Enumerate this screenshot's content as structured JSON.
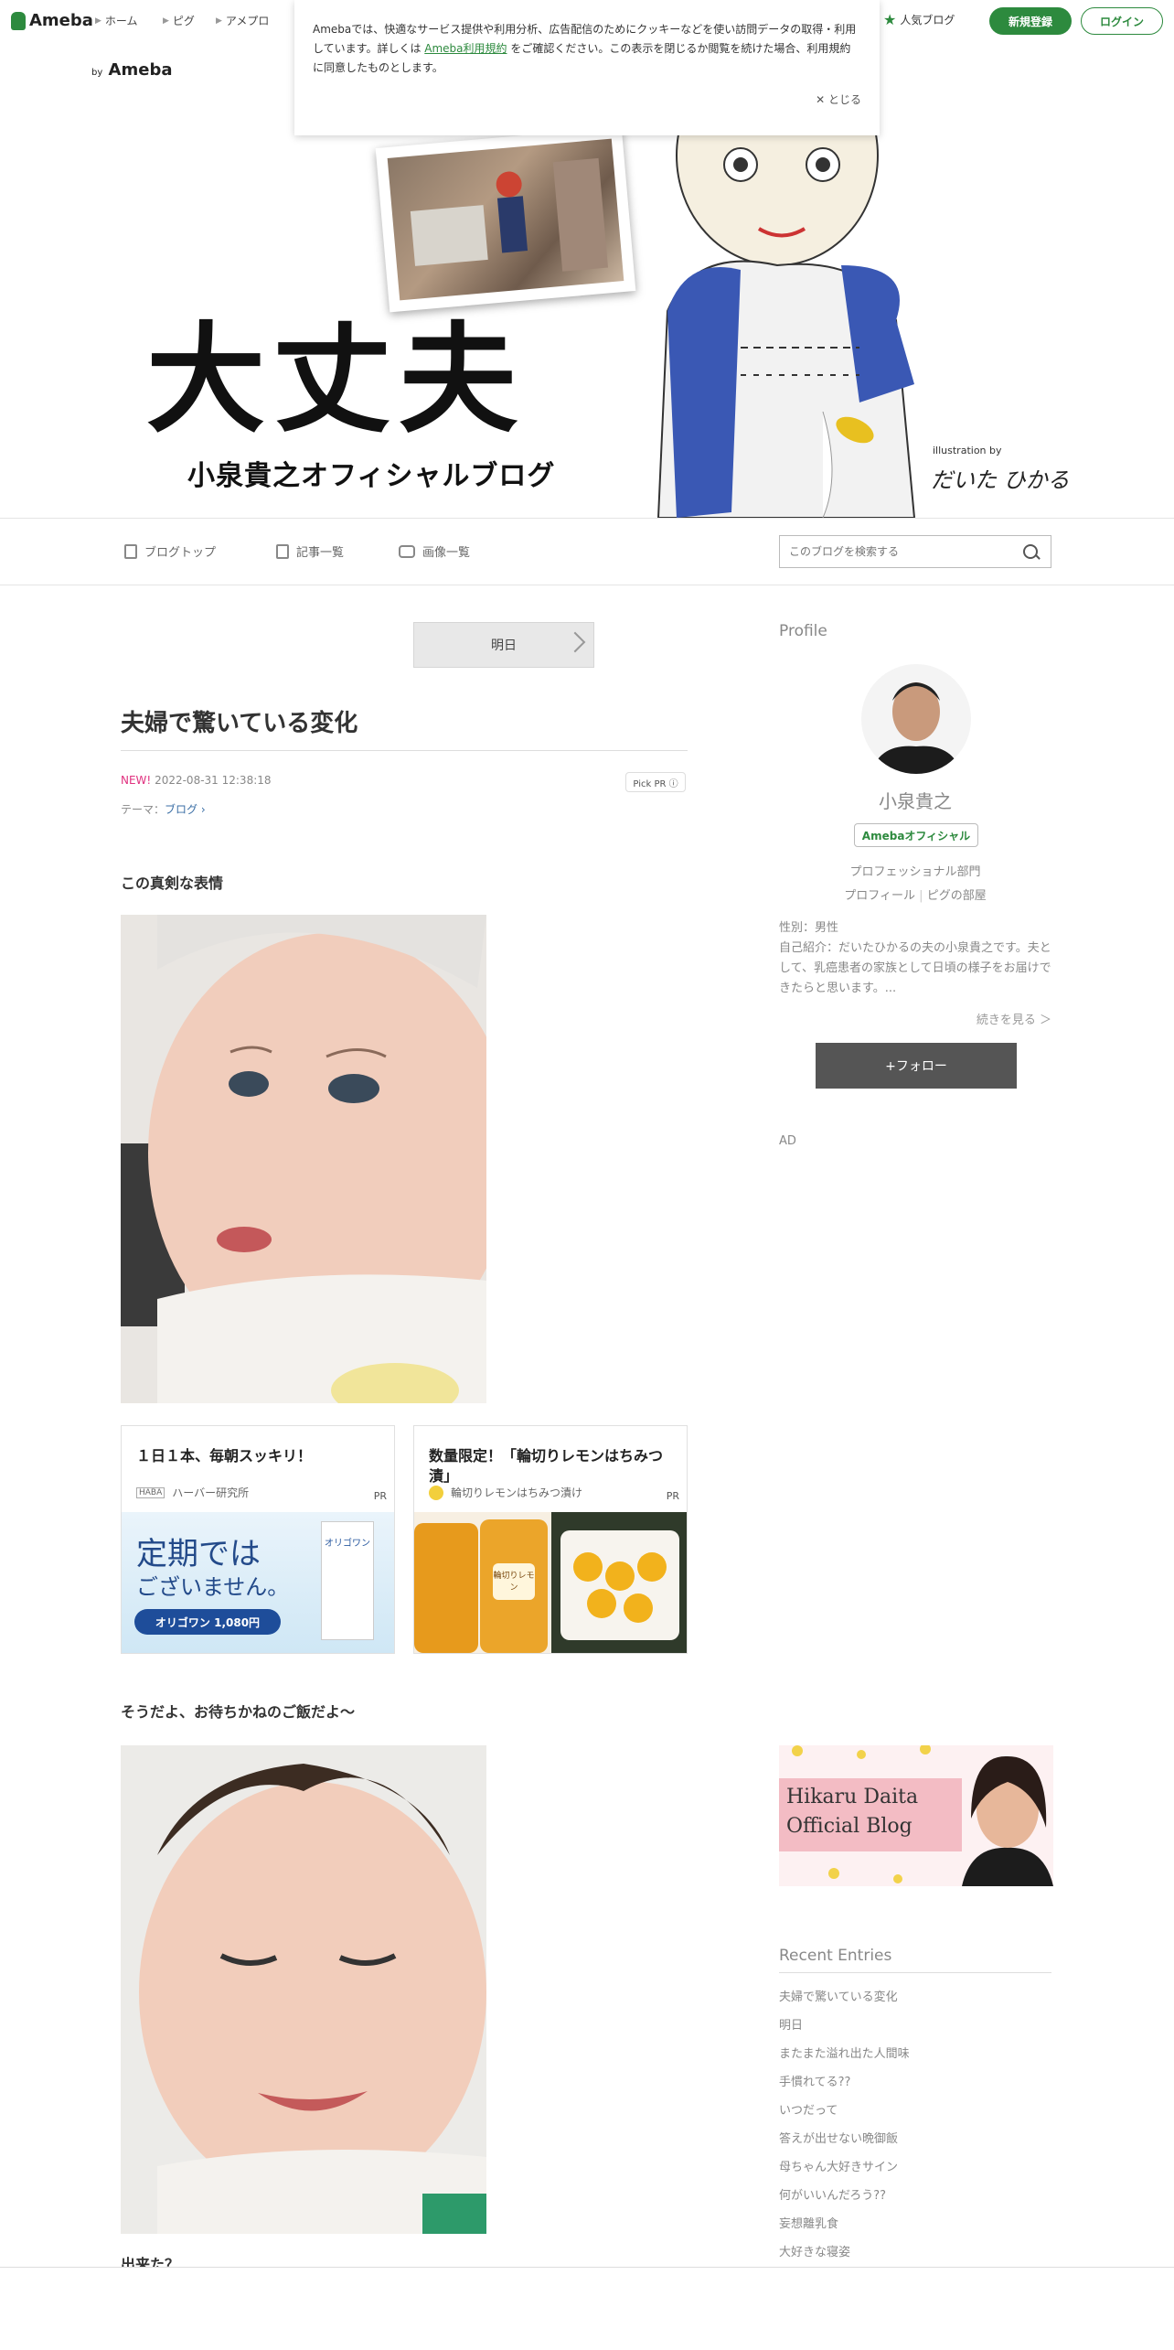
{
  "topbar": {
    "logo": "Ameba",
    "nav": [
      "ホーム",
      "ピグ",
      "アメプロ"
    ],
    "popular": "人気ブログ",
    "register": "新規登録",
    "login": "ログイン"
  },
  "cookie": {
    "text_before": "Amebaでは、快適なサービス提供や利用分析、広告配信のためにクッキーなどを使い訪問データの取得・利用しています。詳しくは ",
    "link": "Ameba利用規約",
    "text_after": " をご確認ください。この表示を閉じるか閲覧を続けた場合、利用規約に同意したものとします。",
    "close": "✕ とじる"
  },
  "header": {
    "by_ameba": "Ameba",
    "by_prefix": "by",
    "title": "大丈夫",
    "subtitle": "小泉貴之オフィシャルブログ",
    "illustration_by": "illustration by",
    "signature": "だいた ひかる"
  },
  "blog_nav": {
    "items": [
      "ブログトップ",
      "記事一覧",
      "画像一覧"
    ],
    "search_placeholder": "このブログを検索する"
  },
  "entry": {
    "next_label": "明日",
    "title": "夫婦で驚いている変化",
    "new_badge": "NEW!",
    "datetime": "2022-08-31 12:38:18",
    "pickpr": "Pick PR ⓘ",
    "theme_label": "テーマ：",
    "theme": "ブログ ›",
    "heading1": "この真剣な表情",
    "heading2": "そうだよ、お待ちかねのご飯だよ〜",
    "heading3": "出来た？"
  },
  "ads": [
    {
      "title": "１日１本、毎朝スッキリ！",
      "sponsor": "ハーバー研究所",
      "sponsor_logo": "HABA",
      "pr": "PR",
      "img_text1": "定期では",
      "img_text2": "ございません。",
      "img_text3": "オリゴワン 1,080円",
      "product": "オリゴワン"
    },
    {
      "title": "数量限定！「輪切りレモンはちみつ漬」",
      "sponsor": "輪切りレモンはちみつ漬け",
      "pr": "PR",
      "jar_label": "輪切りレモン"
    }
  ],
  "sidebar": {
    "profile_heading": "Profile",
    "name": "小泉貴之",
    "badge": "Amebaオフィシャル",
    "category": "プロフェッショナル部門",
    "links": [
      "プロフィール",
      "ピグの部屋"
    ],
    "gender": "性別：男性",
    "intro": "自己紹介：だいたひかるの夫の小泉貴之です。夫として、乳癌患者の家族として日頃の様子をお届けできたらと思います。...",
    "more": "続きを見る ＞",
    "follow": "+フォロー",
    "ad": "AD",
    "banner_line1": "Hikaru Daita",
    "banner_line2": "Official Blog",
    "recent_heading": "Recent Entries",
    "recent": [
      "夫婦で驚いている変化",
      "明日",
      "またまた溢れ出た人間味",
      "手慣れてる??",
      "いつだって",
      "答えが出せない晩御飯",
      "母ちゃん大好きサイン",
      "何がいいんだろう??",
      "妄想離乳食",
      "大好きな寝姿"
    ]
  },
  "colors": {
    "brand": "#2d8a3e",
    "new": "#e0317f",
    "link": "#3a6ea5"
  }
}
